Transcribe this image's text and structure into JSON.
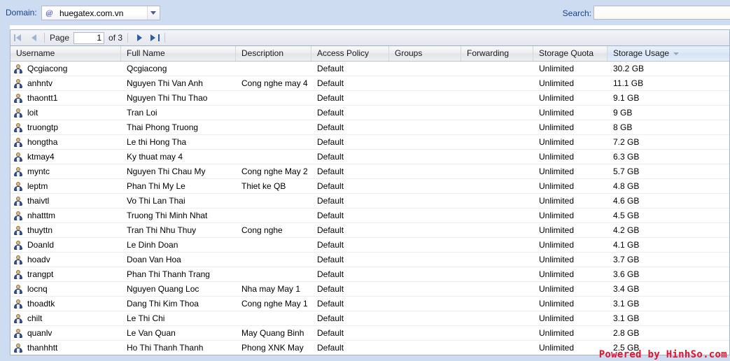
{
  "top_bar": {
    "domain_label": "Domain:",
    "domain_icon": "at-sign-icon",
    "domain_value": "huegatex.com.vn",
    "search_label": "Search:",
    "search_value": "",
    "search_placeholder": ""
  },
  "toolbar": {
    "first_page_icon": "first-page-icon",
    "prev_page_icon": "prev-page-icon",
    "page_label": "Page",
    "page_value": "1",
    "of_label": "of 3",
    "next_page_icon": "next-page-icon",
    "last_page_icon": "last-page-icon"
  },
  "grid": {
    "columns": [
      {
        "key": "username",
        "label": "Username"
      },
      {
        "key": "fullname",
        "label": "Full Name"
      },
      {
        "key": "description",
        "label": "Description"
      },
      {
        "key": "access_policy",
        "label": "Access Policy"
      },
      {
        "key": "groups",
        "label": "Groups"
      },
      {
        "key": "forwarding",
        "label": "Forwarding"
      },
      {
        "key": "storage_quota",
        "label": "Storage Quota"
      },
      {
        "key": "storage_usage",
        "label": "Storage Usage"
      }
    ],
    "sorted_column": "storage_usage",
    "sort_direction": "desc",
    "rows": [
      {
        "username": "Qcgiacong",
        "fullname": "Qcgiacong",
        "description": "",
        "access_policy": "Default",
        "groups": "",
        "forwarding": "",
        "storage_quota": "Unlimited",
        "storage_usage": "30.2 GB"
      },
      {
        "username": "anhntv",
        "fullname": "Nguyen Thi Van Anh",
        "description": "Cong nghe may 4",
        "access_policy": "Default",
        "groups": "",
        "forwarding": "",
        "storage_quota": "Unlimited",
        "storage_usage": "11.1 GB"
      },
      {
        "username": "thaontt1",
        "fullname": "Nguyen Thi Thu Thao",
        "description": "",
        "access_policy": "Default",
        "groups": "",
        "forwarding": "",
        "storage_quota": "Unlimited",
        "storage_usage": "9.1 GB"
      },
      {
        "username": "loit",
        "fullname": "Tran Loi",
        "description": "",
        "access_policy": "Default",
        "groups": "",
        "forwarding": "",
        "storage_quota": "Unlimited",
        "storage_usage": "9 GB"
      },
      {
        "username": "truongtp",
        "fullname": "Thai Phong Truong",
        "description": "",
        "access_policy": "Default",
        "groups": "",
        "forwarding": "",
        "storage_quota": "Unlimited",
        "storage_usage": "8 GB"
      },
      {
        "username": "hongtha",
        "fullname": "Le thi Hong Tha",
        "description": "",
        "access_policy": "Default",
        "groups": "",
        "forwarding": "",
        "storage_quota": "Unlimited",
        "storage_usage": "7.2 GB"
      },
      {
        "username": "ktmay4",
        "fullname": "Ky thuat may 4",
        "description": "",
        "access_policy": "Default",
        "groups": "",
        "forwarding": "",
        "storage_quota": "Unlimited",
        "storage_usage": "6.3 GB"
      },
      {
        "username": "myntc",
        "fullname": "Nguyen Thi Chau My",
        "description": "Cong nghe May 2",
        "access_policy": "Default",
        "groups": "",
        "forwarding": "",
        "storage_quota": "Unlimited",
        "storage_usage": "5.7 GB"
      },
      {
        "username": "leptm",
        "fullname": "Phan Thi My Le",
        "description": "Thiet ke QB",
        "access_policy": "Default",
        "groups": "",
        "forwarding": "",
        "storage_quota": "Unlimited",
        "storage_usage": "4.8 GB"
      },
      {
        "username": "thaivtl",
        "fullname": "Vo Thi Lan Thai",
        "description": "",
        "access_policy": "Default",
        "groups": "",
        "forwarding": "",
        "storage_quota": "Unlimited",
        "storage_usage": "4.6 GB"
      },
      {
        "username": "nhatttm",
        "fullname": "Truong Thi Minh Nhat",
        "description": "",
        "access_policy": "Default",
        "groups": "",
        "forwarding": "",
        "storage_quota": "Unlimited",
        "storage_usage": "4.5 GB"
      },
      {
        "username": "thuyttn",
        "fullname": "Tran Thi Nhu Thuy",
        "description": "Cong nghe",
        "access_policy": "Default",
        "groups": "",
        "forwarding": "",
        "storage_quota": "Unlimited",
        "storage_usage": "4.2 GB"
      },
      {
        "username": "Doanld",
        "fullname": "Le Dinh Doan",
        "description": "",
        "access_policy": "Default",
        "groups": "",
        "forwarding": "",
        "storage_quota": "Unlimited",
        "storage_usage": "4.1 GB"
      },
      {
        "username": "hoadv",
        "fullname": "Doan Van Hoa",
        "description": "",
        "access_policy": "Default",
        "groups": "",
        "forwarding": "",
        "storage_quota": "Unlimited",
        "storage_usage": "3.7 GB"
      },
      {
        "username": "trangpt",
        "fullname": "Phan Thi Thanh Trang",
        "description": "",
        "access_policy": "Default",
        "groups": "",
        "forwarding": "",
        "storage_quota": "Unlimited",
        "storage_usage": "3.6 GB"
      },
      {
        "username": "locnq",
        "fullname": "Nguyen Quang Loc",
        "description": "Nha may May 1",
        "access_policy": "Default",
        "groups": "",
        "forwarding": "",
        "storage_quota": "Unlimited",
        "storage_usage": "3.4 GB"
      },
      {
        "username": "thoadtk",
        "fullname": "Dang Thi Kim Thoa",
        "description": "Cong nghe May 1",
        "access_policy": "Default",
        "groups": "",
        "forwarding": "",
        "storage_quota": "Unlimited",
        "storage_usage": "3.1 GB"
      },
      {
        "username": "chilt",
        "fullname": "Le Thi Chi",
        "description": "",
        "access_policy": "Default",
        "groups": "",
        "forwarding": "",
        "storage_quota": "Unlimited",
        "storage_usage": "3.1 GB"
      },
      {
        "username": "quanlv",
        "fullname": "Le Van Quan",
        "description": "May Quang Binh",
        "access_policy": "Default",
        "groups": "",
        "forwarding": "",
        "storage_quota": "Unlimited",
        "storage_usage": "2.8 GB"
      },
      {
        "username": "thanhhtt",
        "fullname": "Ho Thi Thanh Thanh",
        "description": "Phong XNK May",
        "access_policy": "Default",
        "groups": "",
        "forwarding": "",
        "storage_quota": "Unlimited",
        "storage_usage": "2.5 GB"
      }
    ]
  },
  "watermark": {
    "text": "Powered by HinhSo.com",
    "color": "#e8102a"
  }
}
